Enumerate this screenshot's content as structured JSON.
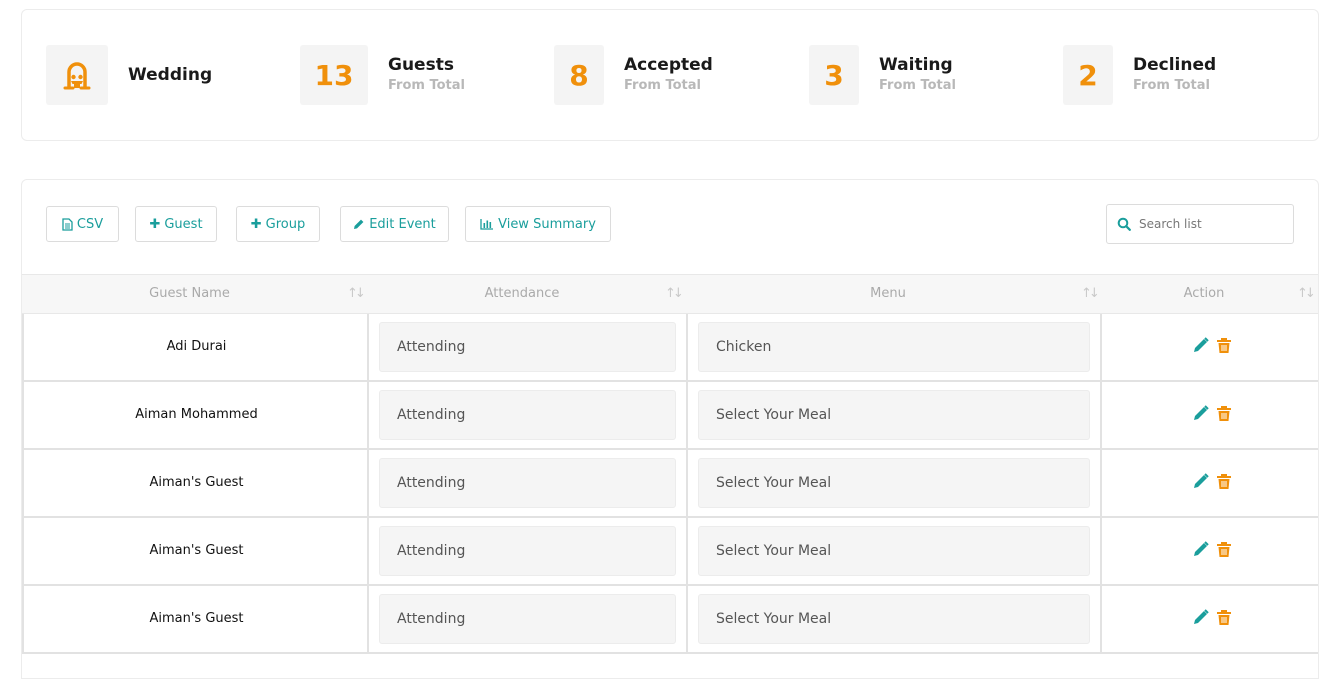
{
  "summary": {
    "event": {
      "label": "Wedding",
      "icon": "wedding-arch-icon"
    },
    "stats": [
      {
        "value": "13",
        "title": "Guests",
        "sub": "From Total"
      },
      {
        "value": "8",
        "title": "Accepted",
        "sub": "From Total"
      },
      {
        "value": "3",
        "title": "Waiting",
        "sub": "From Total"
      },
      {
        "value": "2",
        "title": "Declined",
        "sub": "From Total"
      }
    ]
  },
  "toolbar": {
    "csv": "CSV",
    "guest": "Guest",
    "group": "Group",
    "edit_event": "Edit Event",
    "view_summary": "View Summary",
    "search_placeholder": "Search list"
  },
  "table": {
    "headers": [
      "Guest Name",
      "Attendance",
      "Menu",
      "Action"
    ],
    "rows": [
      {
        "name": "Adi Durai",
        "attendance": "Attending",
        "menu": "Chicken"
      },
      {
        "name": "Aiman Mohammed",
        "attendance": "Attending",
        "menu": "Select Your Meal"
      },
      {
        "name": "Aiman's Guest",
        "attendance": "Attending",
        "menu": "Select Your Meal"
      },
      {
        "name": "Aiman's Guest",
        "attendance": "Attending",
        "menu": "Select Your Meal"
      },
      {
        "name": "Aiman's Guest",
        "attendance": "Attending",
        "menu": "Select Your Meal"
      }
    ]
  },
  "colors": {
    "accent_orange": "#f0900b",
    "accent_teal": "#1a9e9c"
  }
}
